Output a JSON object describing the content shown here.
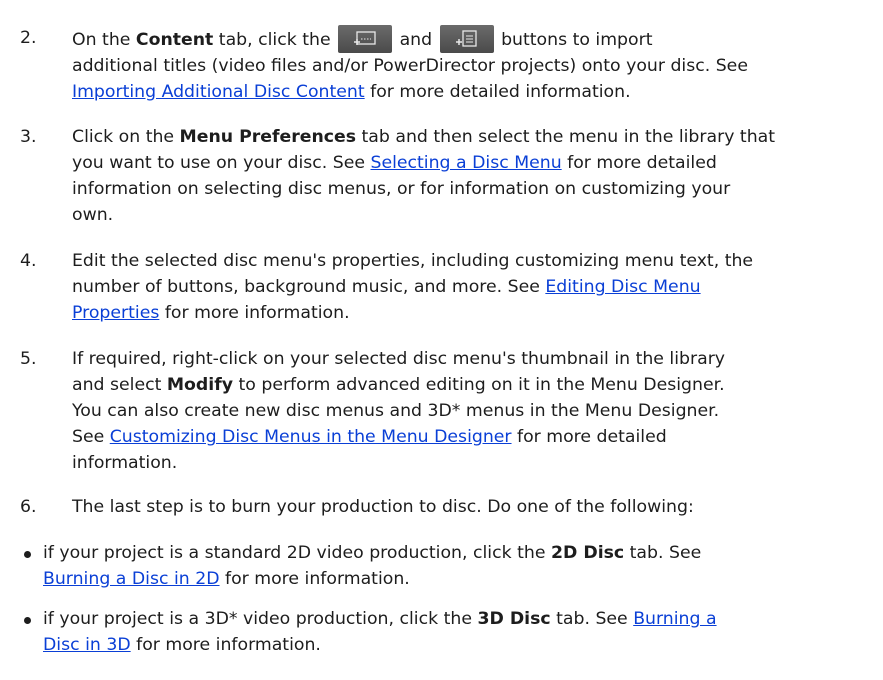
{
  "steps": [
    {
      "number": "2.",
      "l1_a": "On the ",
      "l1_b": "Content",
      "l1_c": " tab, click the ",
      "l1_d": " and ",
      "l1_e": " buttons to import",
      "icon1": "add-title-icon",
      "icon2": "add-project-icon",
      "l2": "additional titles (video files and/or PowerDirector projects) onto your disc. See",
      "l3_link": "Importing Additional Disc Content",
      "l3_rest": " for more detailed information."
    },
    {
      "number": "3.",
      "l1_a": "Click on the ",
      "l1_b": "Menu Preferences",
      "l1_c": " tab and then select the menu in the library that",
      "l2_a": "you want to use on your disc. See ",
      "l2_link": "Selecting a Disc Menu",
      "l2_rest": " for more detailed",
      "l3": "information on selecting disc menus, or for information on customizing your",
      "l4": "own."
    },
    {
      "number": "4.",
      "l1": "Edit the selected disc menu's properties, including customizing menu text, the",
      "l2_a": "number of buttons, background music, and more. See ",
      "l2_link": "Editing Disc Menu",
      "l3_link": "Properties",
      "l3_rest": " for more information."
    },
    {
      "number": "5.",
      "l1": "If required, right-click on your selected disc menu's thumbnail in the library",
      "l2_a": "and select ",
      "l2_b": "Modify",
      "l2_c": " to perform advanced editing on it in the Menu Designer.",
      "l3": "You can also create new disc menus and 3D* menus in the Menu Designer.",
      "l4_a": "See ",
      "l4_link": "Customizing Disc Menus in the Menu Designer",
      "l4_rest": " for more detailed",
      "l5": "information."
    },
    {
      "number": "6.",
      "l1": "The last step is to burn your production to disc. Do one of the following:"
    }
  ],
  "bullets": [
    {
      "l1_a": "if your project is a standard 2D video production, click the ",
      "l1_b": "2D Disc",
      "l1_c": " tab. See",
      "l2_link": "Burning a Disc in 2D",
      "l2_rest": " for more information."
    },
    {
      "l1_a": "if your project is a 3D* video production, click the ",
      "l1_b": "3D Disc",
      "l1_c": " tab. See ",
      "l1_link": "Burning a",
      "l2_link": "Disc in 3D",
      "l2_rest": " for more information."
    }
  ],
  "colors": {
    "link": "#0a3fd6",
    "text": "#1d1d1d"
  }
}
